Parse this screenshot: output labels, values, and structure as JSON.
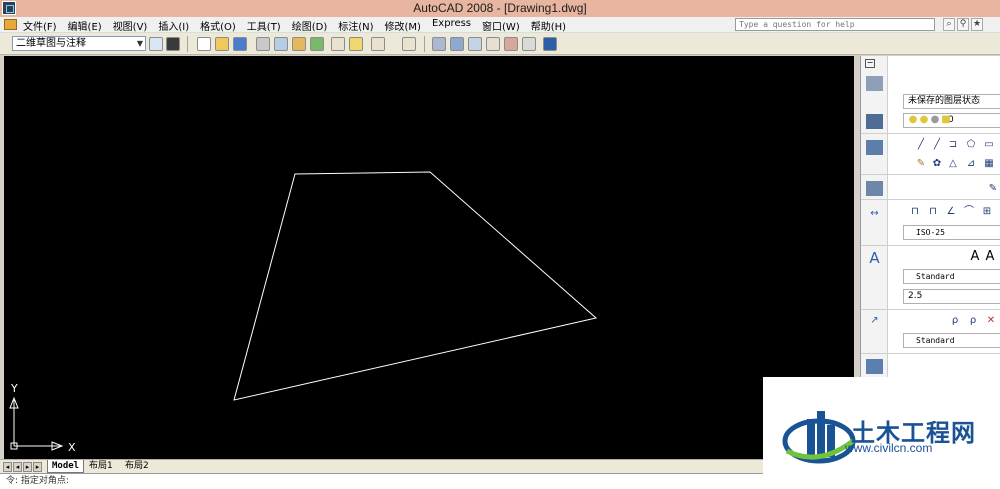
{
  "window": {
    "title": "AutoCAD 2008 - [Drawing1.dwg]"
  },
  "menu": {
    "items": [
      "文件(F)",
      "编辑(E)",
      "视图(V)",
      "插入(I)",
      "格式(O)",
      "工具(T)",
      "绘图(D)",
      "标注(N)",
      "修改(M)",
      "Express",
      "窗口(W)",
      "帮助(H)"
    ],
    "help_placeholder": "Type a question for help"
  },
  "toolbar": {
    "workspace": "二维草图与注释"
  },
  "canvas": {
    "background": "#000000",
    "stroke": "#ffffff",
    "ucs_y_label": "Y",
    "ucs_x_label": "X"
  },
  "tabs": {
    "model": "Model",
    "layout1": "布局1",
    "layout2": "布局2"
  },
  "cmdline": {
    "text": "令: 指定对角点:"
  },
  "panel": {
    "layer_state": "未保存的图层状态",
    "layer_value": "0",
    "dim_style": "ISO-25",
    "text_style": "Standard",
    "text_height": "2.5",
    "multileader_style": "Standard"
  },
  "watermark": {
    "brand": "土木工程网",
    "url": "www.civilcn.com"
  },
  "colors": {
    "brand": "#1a5296",
    "accent": "#6fc43c",
    "title_bar": "#e8b6a0"
  }
}
